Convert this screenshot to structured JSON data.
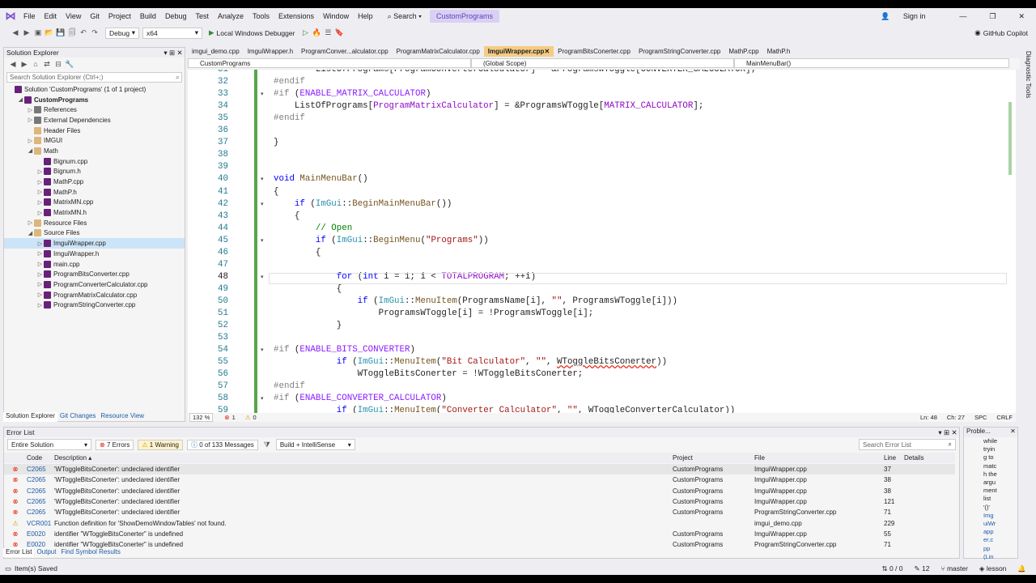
{
  "menu": [
    "File",
    "Edit",
    "View",
    "Git",
    "Project",
    "Build",
    "Debug",
    "Test",
    "Analyze",
    "Tools",
    "Extensions",
    "Window",
    "Help"
  ],
  "search_label": "Search",
  "solution_name": "CustomPrograms",
  "sign_in": "Sign in",
  "github_copilot": "GitHub Copilot",
  "toolbar": {
    "config": "Debug",
    "platform": "x64",
    "run_label": "Local Windows Debugger"
  },
  "solution_explorer": {
    "title": "Solution Explorer",
    "search_placeholder": "Search Solution Explorer (Ctrl+;)",
    "items": [
      {
        "label": "Solution 'CustomPrograms' (1 of 1 project)",
        "indent": 0,
        "twisty": "",
        "color": "#68217a"
      },
      {
        "label": "CustomPrograms",
        "indent": 1,
        "twisty": "◢",
        "color": "#68217a",
        "bold": true
      },
      {
        "label": "References",
        "indent": 2,
        "twisty": "▷",
        "color": "#777777"
      },
      {
        "label": "External Dependencies",
        "indent": 2,
        "twisty": "▷",
        "color": "#777777"
      },
      {
        "label": "Header Files",
        "indent": 2,
        "twisty": "",
        "color": "#dcb67a"
      },
      {
        "label": "IMGUI",
        "indent": 2,
        "twisty": "▷",
        "color": "#dcb67a"
      },
      {
        "label": "Math",
        "indent": 2,
        "twisty": "◢",
        "color": "#dcb67a"
      },
      {
        "label": "Bignum.cpp",
        "indent": 3,
        "twisty": "",
        "color": "#68217a"
      },
      {
        "label": "Bignum.h",
        "indent": 3,
        "twisty": "▷",
        "color": "#68217a"
      },
      {
        "label": "MathP.cpp",
        "indent": 3,
        "twisty": "▷",
        "color": "#68217a"
      },
      {
        "label": "MathP.h",
        "indent": 3,
        "twisty": "▷",
        "color": "#68217a"
      },
      {
        "label": "MatrixMN.cpp",
        "indent": 3,
        "twisty": "▷",
        "color": "#68217a"
      },
      {
        "label": "MatrixMN.h",
        "indent": 3,
        "twisty": "▷",
        "color": "#68217a"
      },
      {
        "label": "Resource Files",
        "indent": 2,
        "twisty": "▷",
        "color": "#dcb67a"
      },
      {
        "label": "Source Files",
        "indent": 2,
        "twisty": "◢",
        "color": "#dcb67a"
      },
      {
        "label": "ImguiWrapper.cpp",
        "indent": 3,
        "twisty": "▷",
        "color": "#68217a",
        "selected": true
      },
      {
        "label": "ImguiWrapper.h",
        "indent": 3,
        "twisty": "▷",
        "color": "#68217a"
      },
      {
        "label": "main.cpp",
        "indent": 3,
        "twisty": "▷",
        "color": "#68217a"
      },
      {
        "label": "ProgramBitsConverter.cpp",
        "indent": 3,
        "twisty": "▷",
        "color": "#68217a"
      },
      {
        "label": "ProgramConverterCalculator.cpp",
        "indent": 3,
        "twisty": "▷",
        "color": "#68217a"
      },
      {
        "label": "ProgramMatrixCalculator.cpp",
        "indent": 3,
        "twisty": "▷",
        "color": "#68217a"
      },
      {
        "label": "ProgramStringConverter.cpp",
        "indent": 3,
        "twisty": "▷",
        "color": "#68217a"
      }
    ],
    "tabs": [
      "Solution Explorer",
      "Git Changes",
      "Resource View"
    ]
  },
  "editor_tabs": [
    "imgui_demo.cpp",
    "ImguiWrapper.h",
    "ProgramConver...alculator.cpp",
    "ProgramMatrixCalculator.cpp",
    "ImguiWrapper.cpp",
    "ProgramBitsConerter.cpp",
    "ProgramStringConverter.cpp",
    "MathP.cpp",
    "MathP.h"
  ],
  "active_tab_index": 4,
  "nav": {
    "project": "CustomPrograms",
    "scope": "(Global Scope)",
    "member": "MainMenuBar()"
  },
  "code_lines": [
    {
      "n": "31",
      "html": "        ListOfPrograms[ProgramConverterCalculator] = &amp;ProgramsWToggle[CONVERTER_CALCULATOR];"
    },
    {
      "n": "32",
      "html": "<span class='pp'>#endif</span>"
    },
    {
      "n": "33",
      "html": "<span class='pp'>#if</span> (<span class='mac'>ENABLE_MATRIX_CALCULATOR</span>)"
    },
    {
      "n": "34",
      "html": "    ListOfPrograms[<span class='pur'>ProgramMatrixCalculator</span>] = &amp;ProgramsWToggle[<span class='pur'>MATRIX_CALCULATOR</span>];"
    },
    {
      "n": "35",
      "html": "<span class='pp'>#endif</span>"
    },
    {
      "n": "36",
      "html": ""
    },
    {
      "n": "37",
      "html": "}"
    },
    {
      "n": "38",
      "html": ""
    },
    {
      "n": "39",
      "html": ""
    },
    {
      "n": "40",
      "html": "<span class='kw'>void</span> <span class='fn'>MainMenuBar</span>()"
    },
    {
      "n": "41",
      "html": "{"
    },
    {
      "n": "42",
      "html": "    <span class='kw'>if</span> (<span class='ty'>ImGui</span>::<span class='fn'>BeginMainMenuBar</span>())"
    },
    {
      "n": "43",
      "html": "    {"
    },
    {
      "n": "44",
      "html": "        <span class='cm'>// Open</span>"
    },
    {
      "n": "45",
      "html": "        <span class='kw'>if</span> (<span class='ty'>ImGui</span>::<span class='fn'>BeginMenu</span>(<span class='str'>\"Programs\"</span>))"
    },
    {
      "n": "46",
      "html": "        {"
    },
    {
      "n": "47",
      "html": ""
    },
    {
      "n": "48",
      "html": "            <span class='kw'>for</span> (<span class='kw'>int</span> i = 1; i &lt; <span class='pur'>TOTALPROGRAM</span>; ++i)"
    },
    {
      "n": "49",
      "html": "            {"
    },
    {
      "n": "50",
      "html": "                <span class='kw'>if</span> (<span class='ty'>ImGui</span>::<span class='fn'>MenuItem</span>(ProgramsName[i], <span class='str'>\"\"</span>, ProgramsWToggle[i]))"
    },
    {
      "n": "51",
      "html": "                    ProgramsWToggle[i] = !ProgramsWToggle[i];"
    },
    {
      "n": "52",
      "html": "            }"
    },
    {
      "n": "53",
      "html": ""
    },
    {
      "n": "54",
      "html": "<span class='pp'>#if</span> (<span class='mac'>ENABLE_BITS_CONVERTER</span>)"
    },
    {
      "n": "55",
      "html": "            <span class='kw'>if</span> (<span class='ty'>ImGui</span>::<span class='fn'>MenuItem</span>(<span class='str'>\"Bit Calculator\"</span>, <span class='str'>\"\"</span>, <span class='squig'>WToggleBitsConerter</span>))"
    },
    {
      "n": "56",
      "html": "                WToggleBitsConerter = !WToggleBitsConerter;"
    },
    {
      "n": "57",
      "html": "<span class='pp'>#endif</span>"
    },
    {
      "n": "58",
      "html": "<span class='pp'>#if</span> (<span class='mac'>ENABLE_CONVERTER_CALCULATOR</span>)"
    },
    {
      "n": "59",
      "html": "            <span class='kw'>if</span> (<span class='ty'>ImGui</span>::<span class='fn'>MenuItem</span>(<span class='str'>\"Converter Calculator\"</span>, <span class='str'>\"\"</span>, WToggleConverterCalculator))"
    }
  ],
  "editor_status": {
    "zoom": "132 %",
    "errors": "1",
    "warnings": "0",
    "position": "Ln: 48",
    "col": "Ch: 27",
    "spc": "SPC",
    "eol": "CRLF"
  },
  "error_list": {
    "title": "Error List",
    "scope": "Entire Solution",
    "errors_btn": "7 Errors",
    "warnings_btn": "1 Warning",
    "messages_btn": "0 of 133 Messages",
    "build_filter": "Build + IntelliSense",
    "search_placeholder": "Search Error List",
    "columns": {
      "code": "Code",
      "desc": "Description",
      "project": "Project",
      "file": "File",
      "line": "Line",
      "details": "Details"
    },
    "rows": [
      {
        "icon": "error",
        "code": "C2065",
        "desc": "'WToggleBitsConerter': undeclared identifier",
        "project": "CustomPrograms",
        "file": "ImguiWrapper.cpp",
        "line": "37"
      },
      {
        "icon": "error",
        "code": "C2065",
        "desc": "'WToggleBitsConerter': undeclared identifier",
        "project": "CustomPrograms",
        "file": "ImguiWrapper.cpp",
        "line": "38"
      },
      {
        "icon": "error",
        "code": "C2065",
        "desc": "'WToggleBitsConerter': undeclared identifier",
        "project": "CustomPrograms",
        "file": "ImguiWrapper.cpp",
        "line": "38"
      },
      {
        "icon": "error",
        "code": "C2065",
        "desc": "'WToggleBitsConerter': undeclared identifier",
        "project": "CustomPrograms",
        "file": "ImguiWrapper.cpp",
        "line": "121"
      },
      {
        "icon": "error",
        "code": "C2065",
        "desc": "'WToggleBitsConerter': undeclared identifier",
        "project": "CustomPrograms",
        "file": "ProgramStringConverter.cpp",
        "line": "71"
      },
      {
        "icon": "warning",
        "code": "VCR001",
        "desc": "Function definition for 'ShowDemoWindowTables' not found.",
        "project": "",
        "file": "imgui_demo.cpp",
        "line": "229"
      },
      {
        "icon": "intellisense",
        "code": "E0020",
        "desc": "identifier \"WToggleBitsConerter\" is undefined",
        "project": "CustomPrograms",
        "file": "ImguiWrapper.cpp",
        "line": "55"
      },
      {
        "icon": "intellisense",
        "code": "E0020",
        "desc": "identifier \"WToggleBitsConerter\" is undefined",
        "project": "CustomPrograms",
        "file": "ProgramStringConverter.cpp",
        "line": "71"
      }
    ],
    "tabs": [
      "Error List",
      "Output",
      "Find Symbol Results"
    ]
  },
  "problem_panel": {
    "title": "Proble...",
    "text_lines": [
      "while",
      "tryin",
      "g to",
      "matc",
      "h the",
      "argu",
      "ment",
      "list",
      "'()'"
    ],
    "link_lines": [
      "Img",
      "uiWr",
      "app",
      "er.c",
      "pp",
      "(Lin"
    ]
  },
  "diagnostic_tools": "Diagnostic Tools",
  "status": {
    "left": "Item(s) Saved",
    "counts": "0 / 0",
    "pencil": "12",
    "branch": "master",
    "repo": "lesson"
  },
  "colors": {
    "accent": "#68217a",
    "active_tab": "#f5cc84",
    "error": "#e51400",
    "warning": "#f2c811",
    "change_bar": "#57a64a"
  }
}
